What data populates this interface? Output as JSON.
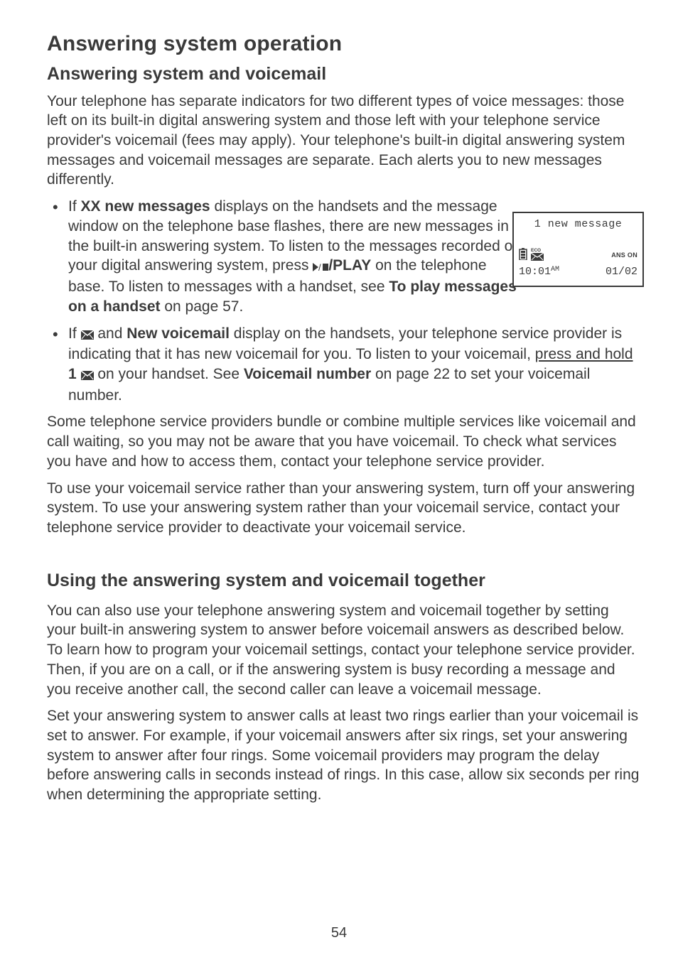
{
  "headings": {
    "h1": "Answering system operation",
    "h2": "Answering system and voicemail",
    "h3": "Using the answering system and voicemail together"
  },
  "para": {
    "intro": "Your telephone has separate indicators for two different types of voice messages: those left on its built-in digital answering system and those left with your telephone service provider's voicemail (fees may apply). Your telephone's built-in digital answering system messages and voicemail messages are separate. Each alerts you to new messages differently.",
    "bullet1_a": "If ",
    "bullet1_b": "XX new messages",
    "bullet1_c": " displays on the handsets and the message window on the telephone base flashes, there are new messages in the built-in answering system. To listen to the messages recorded on your digital answering system, press ",
    "bullet1_d": "/PLAY",
    "bullet1_e": " on the telephone base. To listen to messages with a handset, see ",
    "bullet1_f": "To play messages on a handset",
    "bullet1_g": " on page 57.",
    "bullet2_a": "If ",
    "bullet2_b": " and ",
    "bullet2_c": "New voicemail",
    "bullet2_d": " display on the handsets, your telephone service provider is indicating that it has new voicemail for you. To listen to your voicemail, ",
    "bullet2_e": "press and hold",
    "bullet2_f": " ",
    "bullet2_g": "1 ",
    "bullet2_h": " on your handset. See ",
    "bullet2_i": "Voicemail number",
    "bullet2_j": " on page 22 to set your voicemail number.",
    "p2": "Some telephone service providers bundle or combine multiple services like voicemail and call waiting, so you may not be aware that you have voicemail. To check what services you have and how to access them, contact your telephone service provider.",
    "p3": "To use your voicemail service rather than your answering system, turn off your answering system. To use your answering system rather than your voicemail service, contact your telephone service provider to deactivate your voicemail service.",
    "p4": "You can also use your telephone answering system and voicemail together by setting your built-in answering system to answer before voicemail answers as described below. To learn how to program your voicemail settings, contact your telephone service provider. Then, if you are on a call, or if the answering system is busy recording a message and you receive another call, the second caller can leave a voicemail message.",
    "p5": "Set your answering system to answer calls at least two rings earlier than your voicemail is set to answer. For example, if your voicemail answers after six rings, set your answering system to answer after four rings. Some voicemail providers may program the delay before answering calls in seconds instead of rings. In this case, allow six seconds per ring when determining the appropriate setting."
  },
  "phone_display": {
    "top": "1 new message",
    "ans_on": "ANS ON",
    "time": "10:01",
    "ampm": "AM",
    "date": "01/02"
  },
  "page_number": "54"
}
